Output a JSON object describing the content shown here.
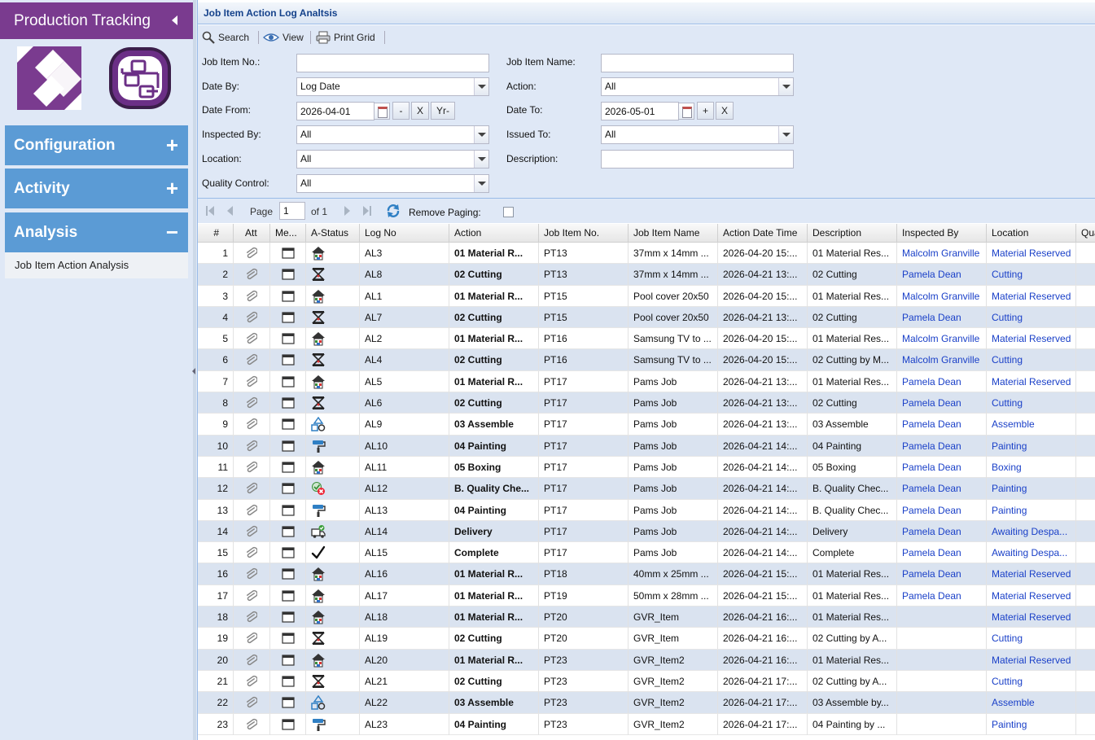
{
  "sidebar": {
    "title": "Production Tracking",
    "sections": [
      {
        "label": "Configuration",
        "sign": "+"
      },
      {
        "label": "Activity",
        "sign": "+"
      },
      {
        "label": "Analysis",
        "sign": "−"
      }
    ],
    "analysis_items": [
      "Job Item Action Analysis"
    ]
  },
  "panel": {
    "title": "Job Item Action Log Analtsis"
  },
  "toolbar": {
    "search": "Search",
    "view": "View",
    "print": "Print Grid"
  },
  "filters": {
    "job_item_no_label": "Job Item No.:",
    "job_item_no_value": "",
    "job_item_name_label": "Job Item Name:",
    "job_item_name_value": "",
    "date_by_label": "Date By:",
    "date_by_value": "Log Date",
    "action_label": "Action:",
    "action_value": "All",
    "date_from_label": "Date From:",
    "date_from_value": "2026-04-01",
    "date_from_minus": "-",
    "date_from_clear": "X",
    "date_from_year": "Yr-",
    "date_to_label": "Date To:",
    "date_to_value": "2026-05-01",
    "date_to_plus": "+",
    "date_to_clear": "X",
    "inspected_by_label": "Inspected By:",
    "inspected_by_value": "All",
    "issued_to_label": "Issued To:",
    "issued_to_value": "All",
    "location_label": "Location:",
    "location_value": "All",
    "description_label": "Description:",
    "description_value": "",
    "quality_control_label": "Quality Control:",
    "quality_control_value": "All"
  },
  "pager": {
    "page_label": "Page",
    "page_value": "1",
    "of_label": "of 1",
    "remove_paging_label": "Remove Paging:"
  },
  "grid": {
    "columns": [
      "#",
      "Att",
      "Me...",
      "A-Status",
      "Log No",
      "Action",
      "Job Item No.",
      "Job Item Name",
      "Action Date Time",
      "Description",
      "Inspected By",
      "Location",
      "Qua"
    ],
    "rows": [
      {
        "n": "1",
        "status": "material",
        "log": "AL3",
        "action": "01 Material R...",
        "job_no": "PT13",
        "job_name": "37mm x 14mm ...",
        "date": "2026-04-20 15:...",
        "desc": "01 Material Res...",
        "inspected": "Malcolm Granville",
        "location": "Material Reserved"
      },
      {
        "n": "2",
        "status": "cutting",
        "log": "AL8",
        "action": "02 Cutting",
        "job_no": "PT13",
        "job_name": "37mm x 14mm ...",
        "date": "2026-04-21 13:...",
        "desc": "02 Cutting",
        "inspected": "Pamela Dean",
        "location": "Cutting"
      },
      {
        "n": "3",
        "status": "material",
        "log": "AL1",
        "action": "01 Material R...",
        "job_no": "PT15",
        "job_name": "Pool cover 20x50",
        "date": "2026-04-20 15:...",
        "desc": "01 Material Res...",
        "inspected": "Malcolm Granville",
        "location": "Material Reserved"
      },
      {
        "n": "4",
        "status": "cutting",
        "log": "AL7",
        "action": "02 Cutting",
        "job_no": "PT15",
        "job_name": "Pool cover 20x50",
        "date": "2026-04-21 13:...",
        "desc": "02 Cutting",
        "inspected": "Pamela Dean",
        "location": "Cutting"
      },
      {
        "n": "5",
        "status": "material",
        "log": "AL2",
        "action": "01 Material R...",
        "job_no": "PT16",
        "job_name": "Samsung TV to ...",
        "date": "2026-04-20 15:...",
        "desc": "01 Material Res...",
        "inspected": "Malcolm Granville",
        "location": "Material Reserved"
      },
      {
        "n": "6",
        "status": "cutting",
        "log": "AL4",
        "action": "02 Cutting",
        "job_no": "PT16",
        "job_name": "Samsung TV to ...",
        "date": "2026-04-20 15:...",
        "desc": "02 Cutting by M...",
        "inspected": "Malcolm Granville",
        "location": "Cutting"
      },
      {
        "n": "7",
        "status": "material",
        "log": "AL5",
        "action": "01 Material R...",
        "job_no": "PT17",
        "job_name": "Pams Job",
        "date": "2026-04-21 13:...",
        "desc": "01 Material Res...",
        "inspected": "Pamela Dean",
        "location": "Material Reserved"
      },
      {
        "n": "8",
        "status": "cutting",
        "log": "AL6",
        "action": "02 Cutting",
        "job_no": "PT17",
        "job_name": "Pams Job",
        "date": "2026-04-21 13:...",
        "desc": "02 Cutting",
        "inspected": "Pamela Dean",
        "location": "Cutting"
      },
      {
        "n": "9",
        "status": "assemble",
        "log": "AL9",
        "action": "03 Assemble",
        "job_no": "PT17",
        "job_name": "Pams Job",
        "date": "2026-04-21 13:...",
        "desc": "03 Assemble",
        "inspected": "Pamela Dean",
        "location": "Assemble"
      },
      {
        "n": "10",
        "status": "painting",
        "log": "AL10",
        "action": "04 Painting",
        "job_no": "PT17",
        "job_name": "Pams Job",
        "date": "2026-04-21 14:...",
        "desc": "04 Painting",
        "inspected": "Pamela Dean",
        "location": "Painting"
      },
      {
        "n": "11",
        "status": "material",
        "log": "AL11",
        "action": "05 Boxing",
        "job_no": "PT17",
        "job_name": "Pams Job",
        "date": "2026-04-21 14:...",
        "desc": "05 Boxing",
        "inspected": "Pamela Dean",
        "location": "Boxing"
      },
      {
        "n": "12",
        "status": "quality",
        "log": "AL12",
        "action": "B. Quality Che...",
        "job_no": "PT17",
        "job_name": "Pams Job",
        "date": "2026-04-21 14:...",
        "desc": "B. Quality Chec...",
        "inspected": "Pamela Dean",
        "location": "Painting"
      },
      {
        "n": "13",
        "status": "painting",
        "log": "AL13",
        "action": "04 Painting",
        "job_no": "PT17",
        "job_name": "Pams Job",
        "date": "2026-04-21 14:...",
        "desc": "B. Quality Chec...",
        "inspected": "Pamela Dean",
        "location": "Painting"
      },
      {
        "n": "14",
        "status": "delivery",
        "log": "AL14",
        "action": "Delivery",
        "job_no": "PT17",
        "job_name": "Pams Job",
        "date": "2026-04-21 14:...",
        "desc": "Delivery",
        "inspected": "Pamela Dean",
        "location": "Awaiting Despa..."
      },
      {
        "n": "15",
        "status": "complete",
        "log": "AL15",
        "action": "Complete",
        "job_no": "PT17",
        "job_name": "Pams Job",
        "date": "2026-04-21 14:...",
        "desc": "Complete",
        "inspected": "Pamela Dean",
        "location": "Awaiting Despa..."
      },
      {
        "n": "16",
        "status": "material",
        "log": "AL16",
        "action": "01 Material R...",
        "job_no": "PT18",
        "job_name": "40mm x 25mm ...",
        "date": "2026-04-21 15:...",
        "desc": "01 Material Res...",
        "inspected": "Pamela Dean",
        "location": "Material Reserved"
      },
      {
        "n": "17",
        "status": "material",
        "log": "AL17",
        "action": "01 Material R...",
        "job_no": "PT19",
        "job_name": "50mm x 28mm ...",
        "date": "2026-04-21 15:...",
        "desc": "01 Material Res...",
        "inspected": "Pamela Dean",
        "location": "Material Reserved"
      },
      {
        "n": "18",
        "status": "material",
        "log": "AL18",
        "action": "01 Material R...",
        "job_no": "PT20",
        "job_name": "GVR_Item",
        "date": "2026-04-21 16:...",
        "desc": "01 Material Res...",
        "inspected": "",
        "location": "Material Reserved"
      },
      {
        "n": "19",
        "status": "cutting",
        "log": "AL19",
        "action": "02 Cutting",
        "job_no": "PT20",
        "job_name": "GVR_Item",
        "date": "2026-04-21 16:...",
        "desc": "02 Cutting by A...",
        "inspected": "",
        "location": "Cutting"
      },
      {
        "n": "20",
        "status": "material",
        "log": "AL20",
        "action": "01 Material R...",
        "job_no": "PT23",
        "job_name": "GVR_Item2",
        "date": "2026-04-21 16:...",
        "desc": "01 Material Res...",
        "inspected": "",
        "location": "Material Reserved"
      },
      {
        "n": "21",
        "status": "cutting",
        "log": "AL21",
        "action": "02 Cutting",
        "job_no": "PT23",
        "job_name": "GVR_Item2",
        "date": "2026-04-21 17:...",
        "desc": "02 Cutting by A...",
        "inspected": "",
        "location": "Cutting"
      },
      {
        "n": "22",
        "status": "assemble",
        "log": "AL22",
        "action": "03 Assemble",
        "job_no": "PT23",
        "job_name": "GVR_Item2",
        "date": "2026-04-21 17:...",
        "desc": "03 Assemble by...",
        "inspected": "",
        "location": "Assemble"
      },
      {
        "n": "23",
        "status": "painting",
        "log": "AL23",
        "action": "04 Painting",
        "job_no": "PT23",
        "job_name": "GVR_Item2",
        "date": "2026-04-21 17:...",
        "desc": "04 Painting by ...",
        "inspected": "",
        "location": "Painting"
      }
    ]
  },
  "colors": {
    "brand_purple": "#7a3b8f",
    "accordion_blue": "#5b9bd5",
    "link_blue": "#1a40c8",
    "alt_row": "#dae3f0"
  }
}
